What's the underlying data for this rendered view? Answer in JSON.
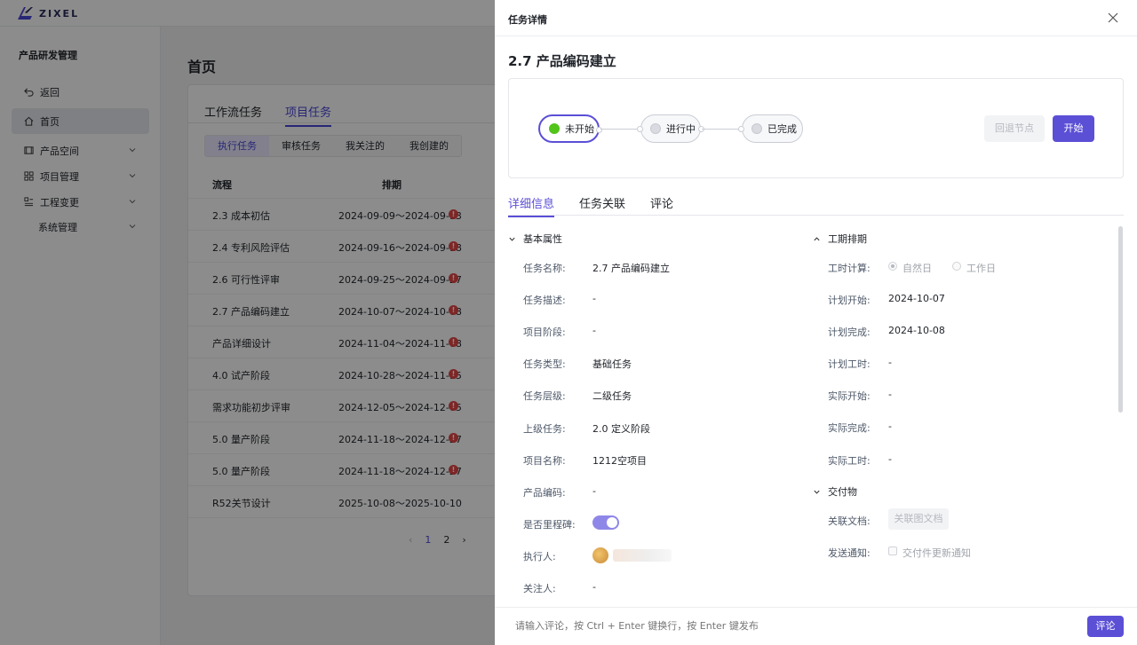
{
  "app": {
    "logo_text": "ZIXEL"
  },
  "sidebar": {
    "title": "产品研发管理",
    "items": [
      {
        "label": "返回",
        "icon": "back-icon"
      },
      {
        "label": "首页",
        "icon": "home-icon"
      },
      {
        "label": "产品空间",
        "icon": "product-icon"
      },
      {
        "label": "项目管理",
        "icon": "grid-icon"
      },
      {
        "label": "工程变更",
        "icon": "list-icon"
      },
      {
        "label": "系统管理",
        "icon": ""
      }
    ]
  },
  "page": {
    "title": "首页",
    "tabs": [
      "工作流任务",
      "项目任务"
    ],
    "subtabs": [
      "执行任务",
      "审核任务",
      "我关注的",
      "我创建的"
    ],
    "table": {
      "headers": [
        "流程",
        "排期"
      ],
      "rows": [
        {
          "name": "2.3 成本初估",
          "date": "2024-09-09～2024-09-13",
          "warn": true
        },
        {
          "name": "2.4 专利风险评估",
          "date": "2024-09-16～2024-09-18",
          "warn": true
        },
        {
          "name": "2.6 可行性评审",
          "date": "2024-09-25～2024-09-27",
          "warn": true
        },
        {
          "name": "2.7 产品编码建立",
          "date": "2024-10-07～2024-10-08",
          "warn": true
        },
        {
          "name": "产品详细设计",
          "date": "2024-11-04～2024-11-08",
          "warn": true
        },
        {
          "name": "4.0 试产阶段",
          "date": "2024-10-28～2024-11-15",
          "warn": true
        },
        {
          "name": "需求功能初步评审",
          "date": "2024-12-05～2024-12-05",
          "warn": true
        },
        {
          "name": "5.0 量产阶段",
          "date": "2024-11-18～2024-12-27",
          "warn": true
        },
        {
          "name": "5.0 量产阶段",
          "date": "2024-11-18～2024-12-27",
          "warn": true
        },
        {
          "name": "R52关节设计",
          "date": "2025-10-08～2025-10-10",
          "warn": false
        }
      ]
    },
    "pager": {
      "prev": "‹",
      "pages": [
        "1",
        "2"
      ],
      "next": "›"
    }
  },
  "drawer": {
    "title": "任务详情",
    "task_title": "2.7 产品编码建立",
    "flow": {
      "nodes": [
        "未开始",
        "进行中",
        "已完成"
      ],
      "current_index": 0,
      "back_button": "回退节点",
      "start_button": "开始"
    },
    "tabs": [
      "详细信息",
      "任务关联",
      "评论"
    ],
    "basic": {
      "section_title": "基本属性",
      "fields": [
        {
          "label": "任务名称:",
          "value": "2.7 产品编码建立"
        },
        {
          "label": "任务描述:",
          "value": "-"
        },
        {
          "label": "项目阶段:",
          "value": "-"
        },
        {
          "label": "任务类型:",
          "value": "基础任务"
        },
        {
          "label": "任务层级:",
          "value": "二级任务"
        },
        {
          "label": "上级任务:",
          "value": "2.0 定义阶段"
        },
        {
          "label": "项目名称:",
          "value": "1212空项目"
        },
        {
          "label": "产品编码:",
          "value": "-"
        },
        {
          "label": "是否里程碑:",
          "value": ""
        },
        {
          "label": "执行人:",
          "value": ""
        },
        {
          "label": "关注人:",
          "value": "-"
        }
      ],
      "milestone_on": true
    },
    "schedule": {
      "section_title": "工期排期",
      "calc_label": "工时计算:",
      "calc_options": [
        "自然日",
        "工作日"
      ],
      "fields": [
        {
          "label": "计划开始:",
          "value": "2024-10-07"
        },
        {
          "label": "计划完成:",
          "value": "2024-10-08"
        },
        {
          "label": "计划工时:",
          "value": "-"
        },
        {
          "label": "实际开始:",
          "value": "-"
        },
        {
          "label": "实际完成:",
          "value": "-"
        },
        {
          "label": "实际工时:",
          "value": "-"
        }
      ]
    },
    "deliverables": {
      "section_title": "交付物",
      "doc_label": "关联文档:",
      "doc_button": "关联图文档",
      "notify_label": "发送通知:",
      "notify_option": "交付件更新通知"
    },
    "footer": {
      "placeholder": "请输入评论，按 Ctrl + Enter 键换行，按 Enter 键发布",
      "submit": "评论"
    }
  },
  "colors": {
    "accent": "#5b4fd6",
    "warn": "#e54545",
    "status_green": "#52c41a"
  }
}
